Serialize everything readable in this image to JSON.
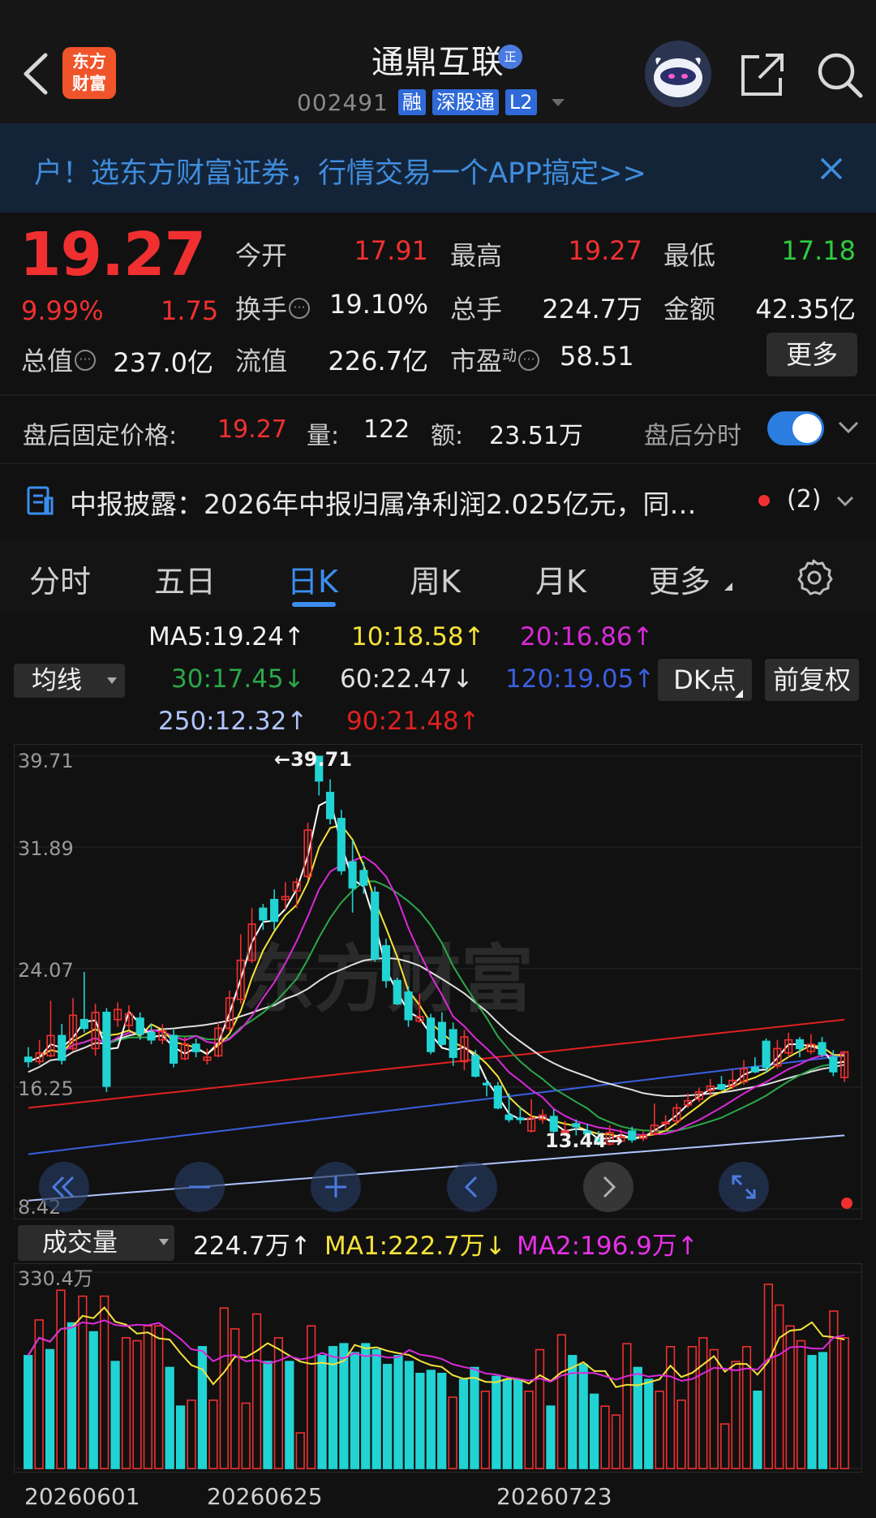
{
  "header": {
    "stock_name": "通鼎互联",
    "badge": "正",
    "logo_line1": "东方",
    "logo_line2": "财富",
    "code": "002491",
    "tags": [
      "融",
      "深股通",
      "L2"
    ]
  },
  "banner": {
    "text": "户！选东方财富证券，行情交易一个APP搞定>>"
  },
  "quote": {
    "price": "19.27",
    "change_pct": "9.99%",
    "change": "1.75",
    "open_label": "今开",
    "open": "17.91",
    "high_label": "最高",
    "high": "19.27",
    "low_label": "最低",
    "low": "17.18",
    "turnover_label": "换手",
    "turnover": "19.10%",
    "volume_label": "总手",
    "volume": "224.7万",
    "amount_label": "金额",
    "amount": "42.35亿",
    "mktcap_label": "总值",
    "mktcap": "237.0亿",
    "float_label": "流值",
    "float": "226.7亿",
    "pe_label": "市盈",
    "pe_sup": "动",
    "pe": "58.51",
    "more": "更多"
  },
  "after_hours": {
    "label": "盘后固定价格:",
    "price": "19.27",
    "vol_label": "量:",
    "vol": "122",
    "amt_label": "额:",
    "amt": "23.51万",
    "toggle_label": "盘后分时",
    "toggle_on": true
  },
  "news": {
    "text": "中报披露：2026年中报归属净利润2.025亿元，同…",
    "count": "(2)"
  },
  "tabs": [
    "分时",
    "五日",
    "日K",
    "周K",
    "月K",
    "更多"
  ],
  "active_tab": "日K",
  "ma_legend": {
    "select": "均线",
    "ma5": "MA5:19.24↑",
    "ma10": "10:18.58↑",
    "ma20": "20:16.86↑",
    "ma30": "30:17.45↓",
    "ma60": "60:22.47↓",
    "ma120": "120:19.05↑",
    "ma250": "250:12.32↑",
    "ma90": "90:21.48↑",
    "dk": "DK点",
    "fq": "前复权"
  },
  "colors": {
    "up": "#f03030",
    "down": "#22d3d3",
    "ma5": "#ffffff",
    "ma10": "#f5e23a",
    "ma20": "#d92ad9",
    "ma30": "#2aa84a",
    "ma60": "#e0e0e0",
    "ma120": "#3b5fe0",
    "ma250": "#b0c4ff",
    "ma90": "#e02020"
  },
  "kchart_labels": {
    "y1": "39.71",
    "y2": "31.89",
    "y3": "24.07",
    "y4": "16.25",
    "y5": "8.42",
    "high_marker": "←39.71",
    "low_marker": "13.44→",
    "watermark": "东方财富"
  },
  "volume": {
    "select": "成交量",
    "vol": "224.7万↑",
    "ma1": "MA1:222.7万↓",
    "ma2": "MA2:196.9万↑",
    "ymax": "330.4万"
  },
  "dates": [
    "20260601",
    "20260625",
    "20260723"
  ],
  "chart_data": {
    "type": "candlestick",
    "ylim": [
      8.42,
      39.71
    ],
    "candles": [
      [
        18.9,
        18.6,
        19.6,
        18.2
      ],
      [
        18.6,
        19.2,
        20.1,
        18.4
      ],
      [
        19.0,
        20.4,
        22.8,
        18.9
      ],
      [
        20.4,
        18.7,
        21.2,
        18.4
      ],
      [
        19.5,
        21.8,
        23.0,
        19.3
      ],
      [
        21.5,
        20.9,
        24.8,
        20.6
      ],
      [
        19.5,
        22.0,
        22.6,
        19.0
      ],
      [
        22.0,
        16.9,
        22.3,
        16.5
      ],
      [
        21.5,
        22.2,
        22.7,
        21.0
      ],
      [
        21.1,
        21.9,
        22.5,
        20.8
      ],
      [
        21.6,
        20.5,
        22.0,
        20.1
      ],
      [
        20.6,
        20.1,
        21.2,
        19.8
      ],
      [
        20.1,
        20.7,
        21.2,
        19.8
      ],
      [
        20.4,
        18.5,
        20.8,
        18.2
      ],
      [
        18.8,
        19.8,
        20.3,
        18.7
      ],
      [
        19.8,
        19.3,
        20.2,
        18.9
      ],
      [
        18.7,
        18.9,
        19.5,
        18.4
      ],
      [
        19.0,
        20.9,
        21.3,
        18.9
      ],
      [
        20.9,
        23.0,
        23.5,
        20.7
      ],
      [
        22.9,
        25.6,
        27.4,
        22.6
      ],
      [
        25.6,
        28.1,
        29.2,
        25.4
      ],
      [
        29.2,
        28.4,
        29.5,
        27.7
      ],
      [
        29.8,
        28.3,
        30.5,
        27.7
      ],
      [
        29.8,
        30.0,
        31.0,
        29.1
      ],
      [
        30.4,
        31.0,
        31.3,
        29.2
      ],
      [
        31.4,
        34.6,
        35.1,
        31.2
      ],
      [
        39.7,
        38.0,
        39.71,
        37.0
      ],
      [
        37.2,
        35.4,
        38.1,
        35.0
      ],
      [
        35.4,
        31.8,
        36.0,
        31.5
      ],
      [
        32.4,
        30.6,
        33.9,
        28.9
      ],
      [
        31.8,
        30.8,
        32.4,
        30.2
      ],
      [
        30.3,
        25.7,
        30.7,
        25.5
      ],
      [
        26.6,
        24.2,
        27.1,
        23.7
      ],
      [
        24.2,
        22.6,
        24.4,
        22.5
      ],
      [
        23.4,
        21.5,
        23.8,
        21.0
      ],
      [
        21.4,
        21.7,
        23.3,
        21.3
      ],
      [
        21.6,
        19.3,
        21.9,
        19.1
      ],
      [
        21.3,
        19.8,
        22.0,
        19.7
      ],
      [
        20.8,
        18.9,
        21.3,
        18.3
      ],
      [
        18.6,
        20.3,
        20.8,
        18.0
      ],
      [
        19.0,
        17.6,
        19.4,
        17.5
      ],
      [
        17.1,
        17.0,
        17.4,
        16.2
      ],
      [
        16.9,
        15.4,
        17.2,
        15.3
      ],
      [
        14.9,
        14.6,
        16.4,
        14.4
      ],
      [
        14.7,
        14.6,
        15.5,
        14.3
      ],
      [
        13.8,
        14.7,
        16.0,
        13.7
      ],
      [
        14.6,
        14.9,
        15.3,
        14.3
      ],
      [
        14.8,
        13.8,
        15.3,
        13.7
      ],
      [
        13.8,
        13.8,
        14.5,
        13.4
      ],
      [
        14.3,
        14.1,
        14.6,
        13.5
      ],
      [
        13.8,
        13.6,
        14.3,
        13.44
      ],
      [
        13.3,
        12.9,
        13.8,
        12.8
      ],
      [
        12.9,
        13.7,
        14.2,
        12.8
      ],
      [
        13.1,
        13.4,
        13.9,
        13.0
      ],
      [
        13.8,
        13.2,
        14.1,
        13.0
      ],
      [
        13.3,
        13.5,
        13.8,
        13.1
      ],
      [
        13.6,
        14.2,
        15.7,
        13.5
      ],
      [
        14.3,
        14.4,
        14.9,
        13.8
      ],
      [
        14.5,
        15.4,
        15.7,
        14.2
      ],
      [
        15.6,
        15.9,
        16.4,
        15.4
      ],
      [
        16.0,
        16.5,
        16.8,
        15.8
      ],
      [
        16.6,
        16.9,
        17.4,
        16.2
      ],
      [
        17.0,
        16.7,
        17.6,
        16.6
      ],
      [
        16.9,
        17.3,
        18.0,
        16.7
      ],
      [
        17.2,
        18.1,
        18.7,
        17.0
      ],
      [
        18.2,
        17.9,
        18.9,
        17.8
      ],
      [
        20.0,
        18.2,
        20.2,
        17.8
      ],
      [
        18.3,
        19.5,
        20.1,
        18.1
      ],
      [
        19.2,
        20.1,
        20.6,
        18.9
      ],
      [
        20.1,
        19.5,
        20.3,
        18.9
      ],
      [
        19.3,
        19.8,
        20.5,
        19.1
      ],
      [
        19.9,
        19.1,
        20.3,
        18.9
      ],
      [
        18.9,
        17.9,
        19.4,
        17.6
      ],
      [
        17.5,
        19.27,
        19.27,
        17.18
      ]
    ],
    "volume_max": 330.4,
    "volumes": [
      [
        190,
        "down"
      ],
      [
        250,
        "up"
      ],
      [
        200,
        "down"
      ],
      [
        300,
        "up"
      ],
      [
        245,
        "down"
      ],
      [
        290,
        "up"
      ],
      [
        230,
        "down"
      ],
      [
        290,
        "up"
      ],
      [
        180,
        "down"
      ],
      [
        220,
        "up"
      ],
      [
        215,
        "up"
      ],
      [
        240,
        "up"
      ],
      [
        240,
        "up"
      ],
      [
        170,
        "down"
      ],
      [
        105,
        "down"
      ],
      [
        115,
        "up"
      ],
      [
        205,
        "down"
      ],
      [
        115,
        "up"
      ],
      [
        270,
        "up"
      ],
      [
        235,
        "up"
      ],
      [
        110,
        "up"
      ],
      [
        260,
        "up"
      ],
      [
        180,
        "down"
      ],
      [
        220,
        "up"
      ],
      [
        180,
        "down"
      ],
      [
        60,
        "up"
      ],
      [
        240,
        "up"
      ],
      [
        190,
        "down"
      ],
      [
        205,
        "down"
      ],
      [
        210,
        "down"
      ],
      [
        195,
        "down"
      ],
      [
        210,
        "down"
      ],
      [
        200,
        "down"
      ],
      [
        175,
        "down"
      ],
      [
        190,
        "down"
      ],
      [
        180,
        "down"
      ],
      [
        160,
        "down"
      ],
      [
        165,
        "down"
      ],
      [
        160,
        "down"
      ],
      [
        120,
        "up"
      ],
      [
        150,
        "down"
      ],
      [
        170,
        "down"
      ],
      [
        130,
        "up"
      ],
      [
        155,
        "down"
      ],
      [
        150,
        "down"
      ],
      [
        150,
        "down"
      ],
      [
        130,
        "up"
      ],
      [
        200,
        "up"
      ],
      [
        105,
        "down"
      ],
      [
        225,
        "up"
      ],
      [
        190,
        "down"
      ],
      [
        175,
        "down"
      ],
      [
        125,
        "down"
      ],
      [
        105,
        "up"
      ],
      [
        90,
        "up"
      ],
      [
        210,
        "up"
      ],
      [
        170,
        "down"
      ],
      [
        150,
        "down"
      ],
      [
        130,
        "up"
      ],
      [
        205,
        "up"
      ],
      [
        115,
        "up"
      ],
      [
        205,
        "up"
      ],
      [
        220,
        "up"
      ],
      [
        200,
        "up"
      ],
      [
        75,
        "up"
      ],
      [
        180,
        "up"
      ],
      [
        205,
        "up"
      ],
      [
        130,
        "down"
      ],
      [
        310,
        "up"
      ],
      [
        275,
        "up"
      ],
      [
        240,
        "up"
      ],
      [
        215,
        "up"
      ],
      [
        190,
        "down"
      ],
      [
        195,
        "down"
      ],
      [
        265,
        "up"
      ],
      [
        220,
        "up"
      ]
    ]
  }
}
